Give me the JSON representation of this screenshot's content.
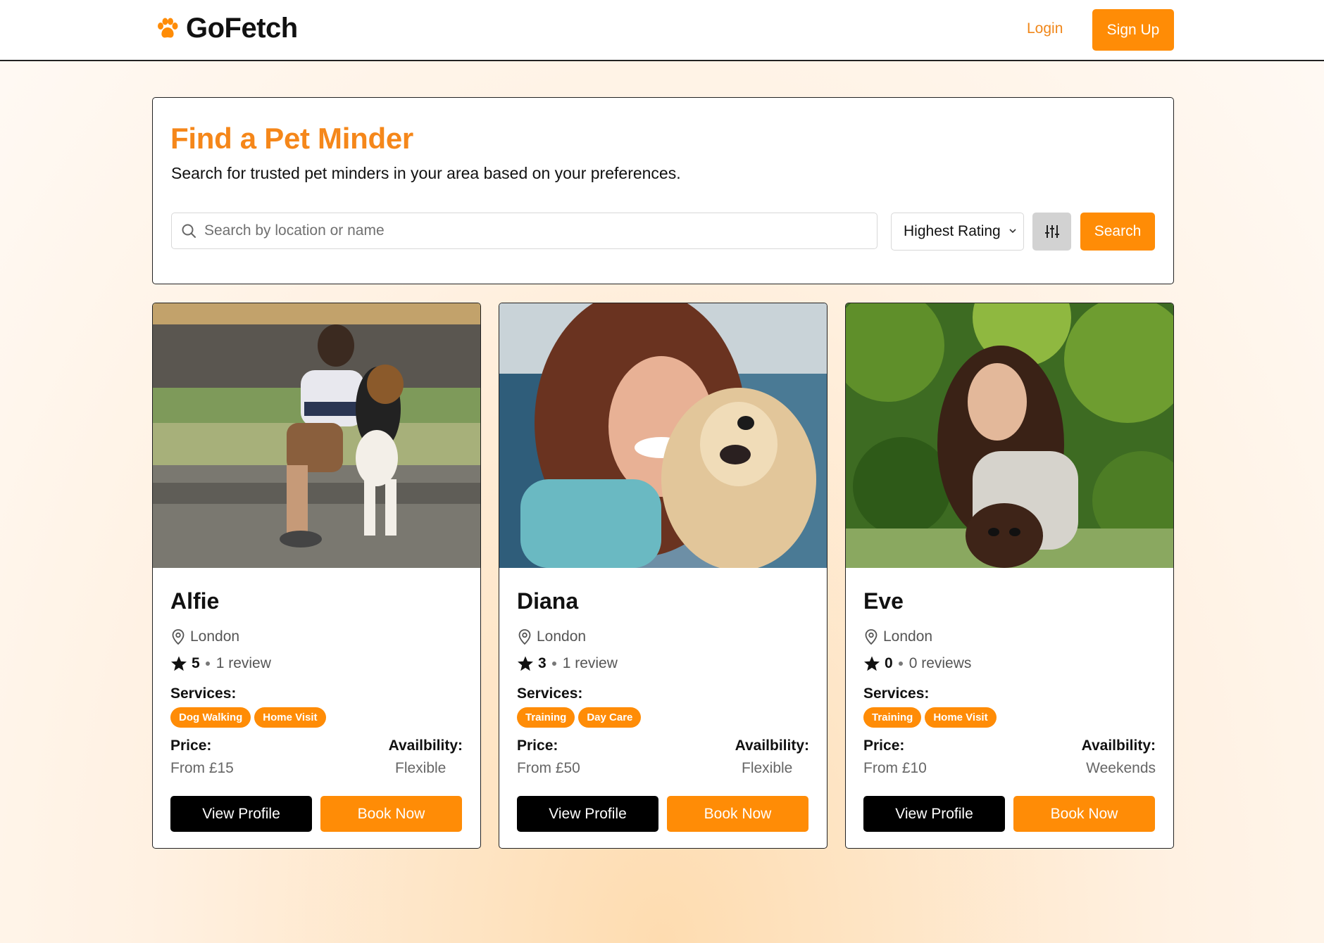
{
  "header": {
    "brand": "GoFetch",
    "brand_icon": "paw-icon",
    "login_label": "Login",
    "signup_label": "Sign Up"
  },
  "search": {
    "title": "Find a Pet Minder",
    "subtitle": "Search for trusted pet minders in your area based on your preferences.",
    "placeholder": "Search by location or name",
    "value": "",
    "sort_selected": "Highest Rating",
    "filter_icon": "sliders-icon",
    "button_label": "Search"
  },
  "colors": {
    "accent": "#ff8c06",
    "title_orange": "#f5871a",
    "dark_button": "#000000"
  },
  "labels": {
    "services": "Services:",
    "price": "Price:",
    "availability": "Availbility:",
    "view_profile": "View Profile",
    "book_now": "Book Now"
  },
  "minders": [
    {
      "name": "Alfie",
      "location": "London",
      "rating": "5",
      "reviews": "1 review",
      "services": [
        "Dog Walking",
        "Home Visit"
      ],
      "price": "From £15",
      "availability": "Flexible"
    },
    {
      "name": "Diana",
      "location": "London",
      "rating": "3",
      "reviews": "1 review",
      "services": [
        "Training",
        "Day Care"
      ],
      "price": "From £50",
      "availability": "Flexible"
    },
    {
      "name": "Eve",
      "location": "London",
      "rating": "0",
      "reviews": "0 reviews",
      "services": [
        "Training",
        "Home Visit"
      ],
      "price": "From £10",
      "availability": "Weekends"
    }
  ]
}
